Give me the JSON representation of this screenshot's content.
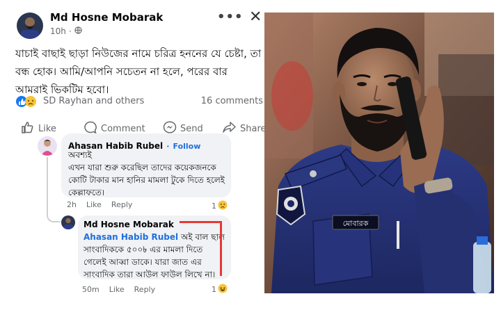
{
  "post": {
    "author": "Md Hosne Mobarak",
    "time": "10h",
    "globe_icon": "globe-icon",
    "more_icon": "more-dots-icon",
    "close_icon": "close-icon",
    "body_lines": [
      "যাচাই বাছাই ছাড়া নিউজের নামে চরিত্র হননের যে চেষ্টা, তা",
      "বন্ধ হোক। আমি/আপনি সচেতন না হলে, পরের বার",
      "আমরাই ভিকটিম হবো।"
    ],
    "reactions_text": "SD Rayhan and others",
    "comments_count": "16 comments",
    "actions": {
      "like": "Like",
      "comment": "Comment",
      "send": "Send",
      "share": "Share"
    }
  },
  "comment1": {
    "author": "Ahasan Habib Rubel",
    "separator": "·",
    "follow": "Follow",
    "lines": [
      "অবশ্যই",
      "এখন যারা শুরু করেছিল তাদের কয়েকজনকে",
      "কোটি টাকার মান হানির মামলা টুকে দিতে হলেই",
      "কেল্লাফতে।"
    ],
    "time": "2h",
    "like": "Like",
    "reply": "Reply",
    "react_count": "1"
  },
  "reply1": {
    "author": "Md Hosne Mobarak",
    "mention": "Ahasan Habib Rubel",
    "first_line_rest": " অই বাল ছাল",
    "lines": [
      "সাংবাদিককে ৫০০৳ এর মামলা দিতে",
      "গেলেই আব্বা ডাকে। যারা জাত এর",
      "সাংবাদিক তারা আউল ফাউল লিখে না।"
    ],
    "time": "50m",
    "like": "Like",
    "reply": "Reply",
    "react_count": "1"
  },
  "photo": {
    "name_tag": "মোবারক"
  },
  "colors": {
    "link": "#216fdb",
    "uniform": "#23306d",
    "highlight": "#e53935"
  }
}
